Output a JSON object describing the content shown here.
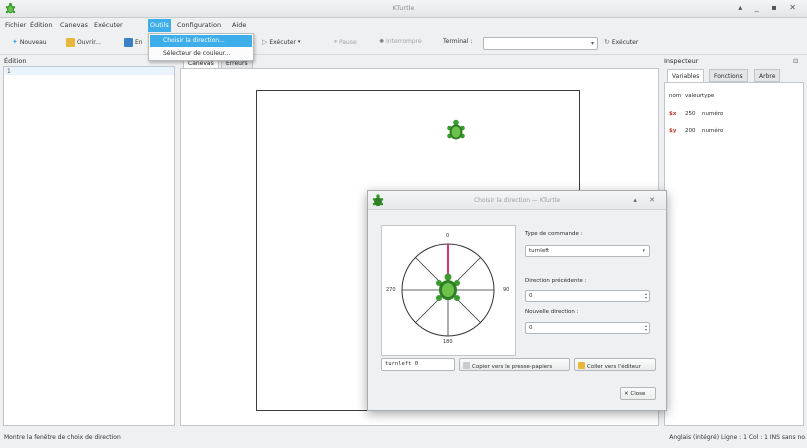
{
  "window": {
    "title": "KTurtle"
  },
  "menubar": [
    "Fichier",
    "Édition",
    "Canevas",
    "Exécuter",
    "Outils",
    "Configuration",
    "Aide"
  ],
  "menubar_active": "Outils",
  "dropdown": {
    "items": [
      "Choisir la direction...",
      "Sélecteur de couleur..."
    ]
  },
  "toolbar": {
    "new": "Nouveau",
    "open": "Ouvrir...",
    "save_partial": "En",
    "run": "Exécuter",
    "pause": "Pause",
    "abort": "Interrompre",
    "terminal_label": "Terminal :",
    "terminal_value": "",
    "run2": "Exécuter"
  },
  "edition": {
    "label": "Édition",
    "line_number": "1"
  },
  "canvas": {
    "tabs": [
      "Canevas",
      "Erreurs"
    ]
  },
  "inspector": {
    "label": "Inspecteur",
    "tabs": [
      "Variables",
      "Fonctions",
      "Arbre"
    ],
    "headers": [
      "nom",
      "valeur",
      "type"
    ],
    "rows": [
      {
        "name": "$x",
        "value": "250",
        "type": "numéro"
      },
      {
        "name": "$y",
        "value": "200",
        "type": "numéro"
      }
    ]
  },
  "dialog": {
    "title": "Choisir la direction — KTurtle",
    "compass": {
      "top": "0",
      "right": "90",
      "bottom": "180",
      "left": "270",
      "angle_deg": 0
    },
    "command_type_label": "Type de commande :",
    "command_type_value": "turnleft",
    "previous_direction_label": "Direction précédente :",
    "previous_direction_value": "0",
    "new_direction_label": "Nouvelle direction :",
    "new_direction_value": "0",
    "command_output": "turnleft 0",
    "copy_button": "Copier vers le presse-papiers",
    "paste_button": "Coller vers l'éditeur",
    "close_button": "Close"
  },
  "statusbar": {
    "message": "Montre la fenêtre de choix de direction",
    "right": "Anglais (intégré)   Ligne : 1 Col : 1   INS   sans no"
  },
  "colors": {
    "accent": "#3daee9",
    "turtle_green": "#3a9b2e",
    "needle": "#e0307a"
  }
}
